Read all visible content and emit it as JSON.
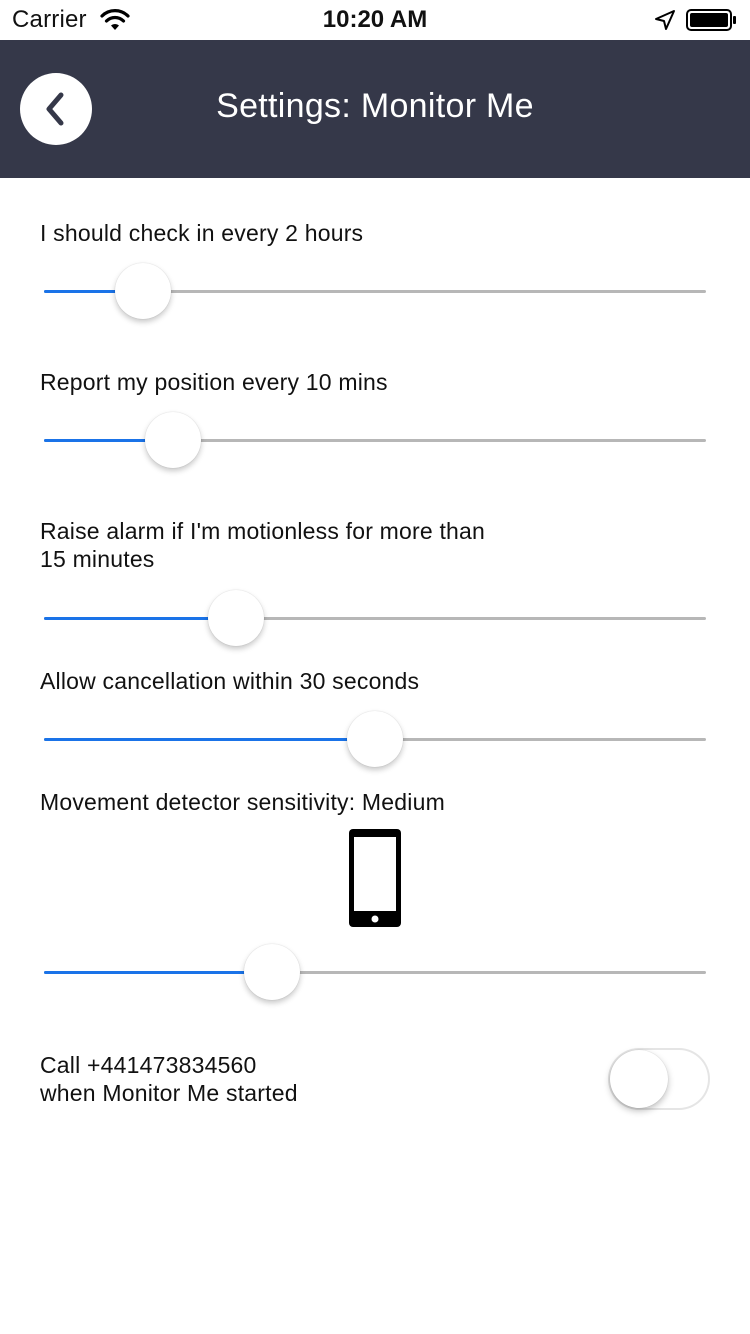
{
  "status_bar": {
    "carrier": "Carrier",
    "time": "10:20 AM"
  },
  "header": {
    "title": "Settings: Monitor Me",
    "background_color": "#353849"
  },
  "settings": [
    {
      "label": "I should check in every 2 hours",
      "slider_fraction": 0.15
    },
    {
      "label": "Report my position every 10 mins",
      "slider_fraction": 0.195
    },
    {
      "label_line1": "Raise alarm if I'm motionless for more than",
      "label_line2": "15 minutes",
      "slider_fraction": 0.29
    },
    {
      "label": "Allow cancellation within 30 seconds",
      "slider_fraction": 0.5
    },
    {
      "label": "Movement detector sensitivity: Medium",
      "icon": "phone-icon",
      "slider_fraction": 0.345
    }
  ],
  "call_setting": {
    "line1": "Call +441473834560",
    "line2": "when Monitor Me started",
    "toggle_on": false
  },
  "colors": {
    "accent": "#1a73e8",
    "track": "#b7b7b7"
  }
}
